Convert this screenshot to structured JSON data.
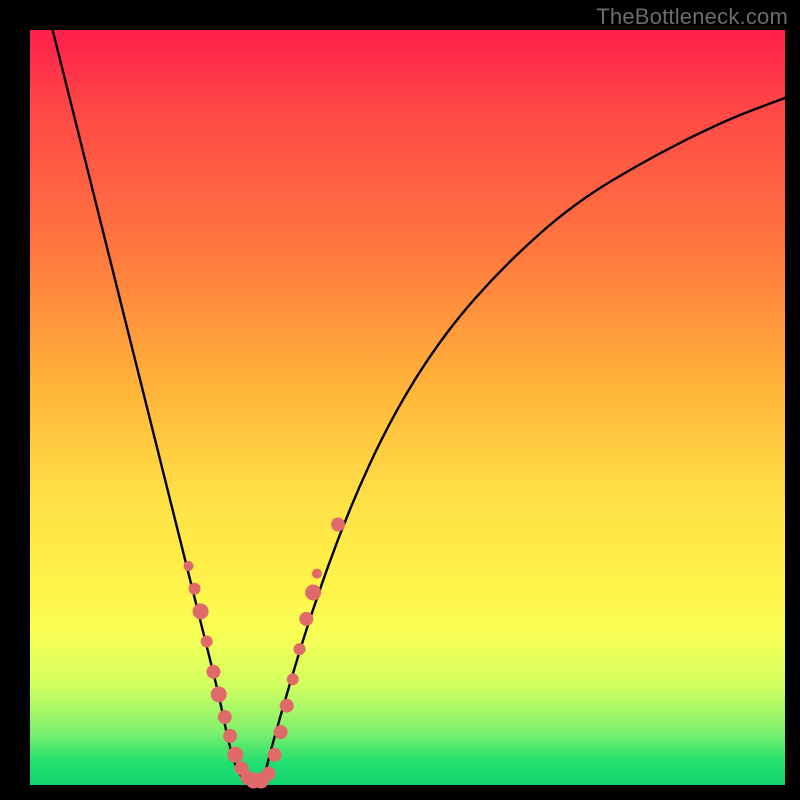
{
  "watermark": "TheBottleneck.com",
  "chart_data": {
    "type": "line",
    "title": "",
    "xlabel": "",
    "ylabel": "",
    "xlim": [
      0,
      100
    ],
    "ylim": [
      0,
      100
    ],
    "series": [
      {
        "name": "bottleneck-curve",
        "x": [
          3,
          6,
          10,
          14,
          18,
          21,
          23,
          25,
          26,
          27,
          28,
          29,
          30,
          31,
          32,
          34,
          37,
          42,
          48,
          55,
          63,
          72,
          82,
          92,
          100
        ],
        "y": [
          100,
          88,
          72,
          56,
          40,
          28,
          20,
          12,
          7,
          3,
          1,
          0,
          0,
          1,
          5,
          12,
          22,
          36,
          49,
          60,
          69,
          77,
          83,
          88,
          91
        ]
      }
    ],
    "markers": {
      "name": "highlighted-points",
      "color": "#e06a6a",
      "points": [
        {
          "x": 21.0,
          "y": 29.0,
          "r": 5
        },
        {
          "x": 21.8,
          "y": 26.0,
          "r": 6
        },
        {
          "x": 22.6,
          "y": 23.0,
          "r": 8
        },
        {
          "x": 23.4,
          "y": 19.0,
          "r": 6
        },
        {
          "x": 24.3,
          "y": 15.0,
          "r": 7
        },
        {
          "x": 25.0,
          "y": 12.0,
          "r": 8
        },
        {
          "x": 25.8,
          "y": 9.0,
          "r": 7
        },
        {
          "x": 26.5,
          "y": 6.5,
          "r": 7
        },
        {
          "x": 27.2,
          "y": 4.0,
          "r": 8
        },
        {
          "x": 28.0,
          "y": 2.2,
          "r": 7
        },
        {
          "x": 28.8,
          "y": 1.0,
          "r": 7
        },
        {
          "x": 29.6,
          "y": 0.6,
          "r": 8
        },
        {
          "x": 30.6,
          "y": 0.6,
          "r": 8
        },
        {
          "x": 31.6,
          "y": 1.5,
          "r": 7
        },
        {
          "x": 32.4,
          "y": 4.0,
          "r": 7
        },
        {
          "x": 33.2,
          "y": 7.0,
          "r": 7
        },
        {
          "x": 34.0,
          "y": 10.5,
          "r": 7
        },
        {
          "x": 34.8,
          "y": 14.0,
          "r": 6
        },
        {
          "x": 35.7,
          "y": 18.0,
          "r": 6
        },
        {
          "x": 36.6,
          "y": 22.0,
          "r": 7
        },
        {
          "x": 37.5,
          "y": 25.5,
          "r": 8
        },
        {
          "x": 38.0,
          "y": 28.0,
          "r": 5
        },
        {
          "x": 40.8,
          "y": 34.5,
          "r": 7
        }
      ]
    }
  }
}
